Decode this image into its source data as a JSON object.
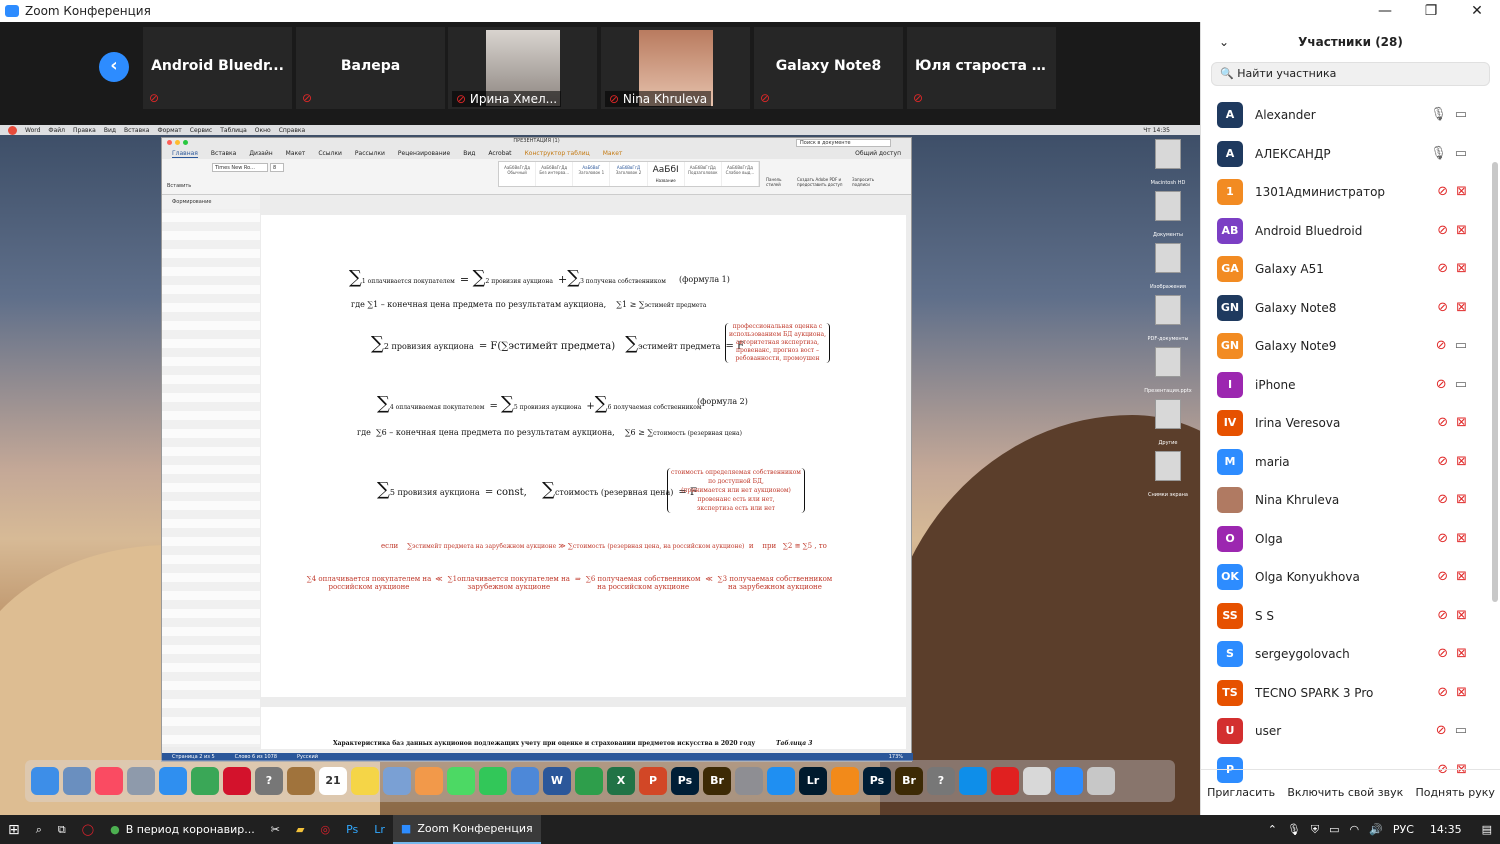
{
  "window": {
    "title": "Zoom Конференция",
    "controls": [
      "—",
      "❐",
      "✕"
    ]
  },
  "strip": {
    "back_icon": "‹",
    "tiles": [
      {
        "name": "Android  Bluedr...",
        "video": false
      },
      {
        "name": "Валера",
        "video": false
      },
      {
        "name": "Ирина Хмел...",
        "video": true
      },
      {
        "name": "Nina Khruleva",
        "video": true
      },
      {
        "name": "Galaxy Note8",
        "video": false
      },
      {
        "name": "Юля  староста  А...",
        "video": false
      }
    ]
  },
  "mac": {
    "menu": [
      "Word",
      "Файл",
      "Правка",
      "Вид",
      "Вставка",
      "Формат",
      "Сервис",
      "Таблица",
      "Окно",
      "Справка"
    ],
    "clock": "Чт 14:35"
  },
  "word": {
    "doc_title": "ПРЕЗЕНТАЦИЯ (1)",
    "search_placeholder": "Поиск в документе",
    "tabs": [
      "Главная",
      "Вставка",
      "Дизайн",
      "Макет",
      "Ссылки",
      "Рассылки",
      "Рецензирование",
      "Вид",
      "Acrobat"
    ],
    "context_tabs": [
      "Конструктор таблиц",
      "Макет"
    ],
    "share": "Общий доступ",
    "font": "Times New Ro...",
    "size": "8",
    "paste": "Вставить",
    "styles": [
      {
        "sample": "АаБбВвГгДд",
        "name": "Обычный"
      },
      {
        "sample": "АаБбВвГгДд",
        "name": "Без интерва..."
      },
      {
        "sample": "АаБбВвГ",
        "name": "Заголовок 1"
      },
      {
        "sample": "АаБбВвГгД",
        "name": "Заголовок 2"
      },
      {
        "sample": "АаБбІ",
        "name": "Название"
      },
      {
        "sample": "АаБбВвГгДд",
        "name": "Подзаголовок"
      },
      {
        "sample": "АаБбВвГгДд",
        "name": "Слабое выд..."
      }
    ],
    "ribbon_right": [
      "Панель стилей",
      "Создать Adobe PDF и предоставить доступ",
      "Запросить подписи"
    ],
    "pane_title": "Формирование",
    "status": [
      "Страница 2 из 5",
      "Слово 6 из 1078",
      "Русский"
    ],
    "zoom": "173%",
    "page2_title": "Характеристика баз данных аукционов подлежащих учету при оценке и страховании предметов искусства в 2020 году",
    "page2_right": "Таблица 3"
  },
  "formulas": {
    "f1": {
      "a": "1 оплачивается покупателем",
      "b": "2 провизия аукциона",
      "c": "3 получена собственником",
      "tag": "(формула 1)"
    },
    "f1_where": {
      "pre": "где",
      "text": "1 –  конечная цена предмета по результатам аукциона,",
      "cmp": "1 ≥",
      "sub": "эстимейт предмета"
    },
    "f_prov": {
      "lhs": "2 провизия аукциона",
      "mid": "= F(∑эстимейт предмета)",
      "rhs": "эстимейт предмета",
      "brace": [
        "профессиональная оценка с",
        "использованием БД аукциона,",
        "авторитетная экспертиза,",
        "провенанс, прогноз вост –",
        "ребованности,  промоушен"
      ]
    },
    "f2": {
      "a": "4 оплачиваемая покупателем",
      "b": "5 провизия аукциона",
      "c": "6 получаемая собственником",
      "tag": "(формула 2)"
    },
    "f2_where": {
      "pre": "где",
      "text": "6 – конечная цена предмета по результатам аукциона,",
      "cmp": "6 ≥",
      "sub": "стоимость (резервная цена)"
    },
    "f_const": {
      "lhs": "5 провизия аукциона",
      "mid": "= const,",
      "rhs": "стоимость (резервная цена)",
      "brace": [
        "стоимость определяемая собственником",
        "по доступной БД,",
        "(принимается или нет аукционом)",
        "провенанс есть или нет,",
        "экспертиза есть или нет"
      ]
    },
    "cond": {
      "if": "если",
      "a": "эстимейт предмета на зарубежном аукционе",
      "b": "стоимость (резервная цена, на российском аукционе)",
      "and": "и",
      "when": "при",
      "eq": "2 ≅ ∑5",
      "then": ", то"
    },
    "result": {
      "a": "4 оплачивается покупателем на российском аукционе",
      "b": "1оплачивается покупателем на зарубежном аукционе",
      "c": "6 получаемая собственником на российском аукционе",
      "d": "3 получаемая собственником на зарубежном аукционе"
    }
  },
  "desktop_icons": [
    "Macintosh HD",
    "Документы",
    "Изображения",
    "PDF-документы",
    "Презентация.pptx",
    "Другие",
    "Снимки экрана"
  ],
  "dock": [
    {
      "icon": "finder-icon",
      "color": "#3d8ee8"
    },
    {
      "icon": "preview-icon",
      "color": "#6a8fbf"
    },
    {
      "icon": "music-icon",
      "color": "#fa4b62"
    },
    {
      "icon": "launchpad-icon",
      "color": "#8e9aab"
    },
    {
      "icon": "safari-icon",
      "color": "#2f8ff0"
    },
    {
      "icon": "chrome-icon",
      "color": "#3aa757"
    },
    {
      "icon": "opera-icon",
      "color": "#d3122c"
    },
    {
      "icon": "unknown-icon",
      "color": "#777777"
    },
    {
      "icon": "notebook-icon",
      "color": "#a0733c"
    },
    {
      "icon": "calendar-icon",
      "color": "#ffffff"
    },
    {
      "icon": "notes-icon",
      "color": "#f5d547"
    },
    {
      "icon": "preview2-icon",
      "color": "#7aa0d4"
    },
    {
      "icon": "photos-icon",
      "color": "#f2994a"
    },
    {
      "icon": "messages-icon",
      "color": "#4cd964"
    },
    {
      "icon": "facetime-icon",
      "color": "#32c759"
    },
    {
      "icon": "keynote-icon",
      "color": "#4d88d8"
    },
    {
      "icon": "word-icon",
      "color": "#2b579a"
    },
    {
      "icon": "numbers-icon",
      "color": "#2e9e4b"
    },
    {
      "icon": "excel-icon",
      "color": "#217346"
    },
    {
      "icon": "powerpoint-icon",
      "color": "#d24726"
    },
    {
      "icon": "photoshop-icon",
      "color": "#001e36"
    },
    {
      "icon": "bridge-icon",
      "color": "#3d2a05"
    },
    {
      "icon": "settings-icon",
      "color": "#8e8e93"
    },
    {
      "icon": "appstore-icon",
      "color": "#1f8ff2"
    },
    {
      "icon": "lightroom-icon",
      "color": "#001a2d"
    },
    {
      "icon": "vlc-icon",
      "color": "#f28a1a"
    },
    {
      "icon": "photoshop2-icon",
      "color": "#001e36"
    },
    {
      "icon": "bridge2-icon",
      "color": "#3d2a05"
    },
    {
      "icon": "unknown2-icon",
      "color": "#777777"
    },
    {
      "icon": "teamviewer-icon",
      "color": "#0e8ee9"
    },
    {
      "icon": "acrobat-icon",
      "color": "#e02020"
    },
    {
      "icon": "archive-icon",
      "color": "#d8d8d8"
    },
    {
      "icon": "zoom-icon",
      "color": "#2d8cff"
    },
    {
      "icon": "trash-icon",
      "color": "#c7c7c7"
    }
  ],
  "dock_labels": [
    "",
    "",
    "",
    "",
    "",
    "",
    "",
    "?",
    "",
    "21",
    "",
    "",
    "",
    "",
    "",
    "",
    "W",
    "",
    "X",
    "P",
    "Ps",
    "Br",
    "",
    "",
    "Lr",
    "",
    "Ps",
    "Br",
    "?",
    "",
    "",
    "",
    "",
    ""
  ],
  "participants": {
    "title": "Участники (28)",
    "search_placeholder": "Найти участника",
    "list": [
      {
        "initials": "A",
        "name": "Alexander",
        "color": "#1f3a5f",
        "mic": "on",
        "cam": "off"
      },
      {
        "initials": "A",
        "name": "АЛЕКСАНДР",
        "color": "#1f3a5f",
        "mic": "on",
        "cam": "off"
      },
      {
        "initials": "1",
        "name": "1301Администратор",
        "color": "#f28b22",
        "mic": "muted",
        "cam": "muted"
      },
      {
        "initials": "AB",
        "name": "Android Bluedroid",
        "color": "#7b3fc4",
        "mic": "muted",
        "cam": "muted"
      },
      {
        "initials": "GA",
        "name": "Galaxy A51",
        "color": "#f28b22",
        "mic": "muted",
        "cam": "muted"
      },
      {
        "initials": "GN",
        "name": "Galaxy Note8",
        "color": "#1f3a5f",
        "mic": "muted",
        "cam": "muted"
      },
      {
        "initials": "GN",
        "name": "Galaxy Note9",
        "color": "#f28b22",
        "mic": "muted",
        "cam": "off"
      },
      {
        "initials": "I",
        "name": "iPhone",
        "color": "#9c27b0",
        "mic": "muted",
        "cam": "off"
      },
      {
        "initials": "IV",
        "name": "Irina Veresova",
        "color": "#e65100",
        "mic": "muted",
        "cam": "muted"
      },
      {
        "initials": "M",
        "name": "maria",
        "color": "#2d8cff",
        "mic": "muted",
        "cam": "muted"
      },
      {
        "initials": "",
        "name": "Nina Khruleva",
        "color": "#b07a62",
        "mic": "muted",
        "cam": "muted"
      },
      {
        "initials": "O",
        "name": "Olga",
        "color": "#9c27b0",
        "mic": "muted",
        "cam": "muted"
      },
      {
        "initials": "OK",
        "name": "Olga Konyukhova",
        "color": "#2d8cff",
        "mic": "muted",
        "cam": "muted"
      },
      {
        "initials": "SS",
        "name": "S S",
        "color": "#e65100",
        "mic": "muted",
        "cam": "muted"
      },
      {
        "initials": "S",
        "name": "sergeygolovach",
        "color": "#2d8cff",
        "mic": "muted",
        "cam": "muted"
      },
      {
        "initials": "TS",
        "name": "TECNO SPARK 3 Pro",
        "color": "#e65100",
        "mic": "muted",
        "cam": "muted"
      },
      {
        "initials": "U",
        "name": "user",
        "color": "#d32f2f",
        "mic": "muted",
        "cam": "off"
      },
      {
        "initials": "P",
        "name": "",
        "color": "#2d8cff",
        "mic": "muted",
        "cam": "muted"
      }
    ],
    "footer": [
      "Пригласить",
      "Включить свой звук",
      "Поднять руку"
    ]
  },
  "taskbar": {
    "apps": [
      "В период коронавир...",
      "Zoom Конференция"
    ],
    "lang": "РУС",
    "time": "14:35"
  }
}
